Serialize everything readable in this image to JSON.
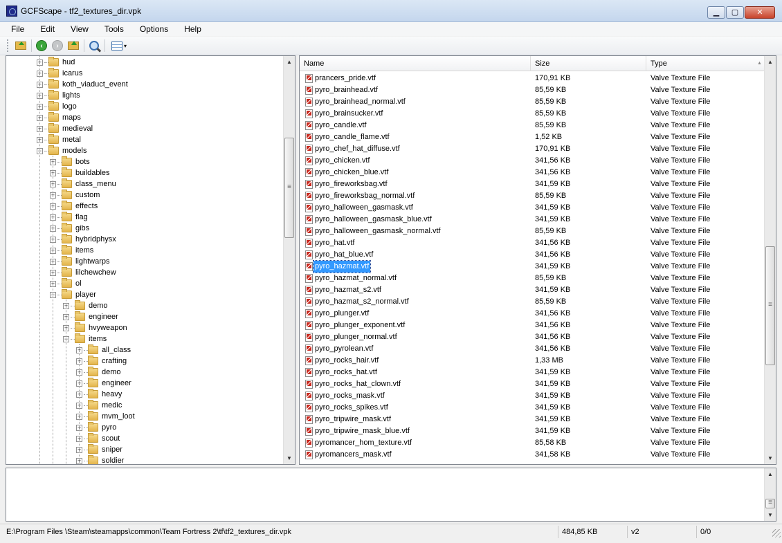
{
  "window": {
    "title": "GCFScape - tf2_textures_dir.vpk",
    "minimize_glyph": "▁",
    "maximize_glyph": "▢",
    "close_glyph": "✕"
  },
  "menu": [
    "File",
    "Edit",
    "View",
    "Tools",
    "Options",
    "Help"
  ],
  "toolbar": {
    "icons": [
      "open-icon",
      "back-icon",
      "forward-icon",
      "up-folder-icon",
      "find-icon",
      "view-mode-icon"
    ],
    "dropdown_glyph": "▾"
  },
  "tree": {
    "items": [
      {
        "label": "hud",
        "level": 2
      },
      {
        "label": "icarus",
        "level": 2
      },
      {
        "label": "koth_viaduct_event",
        "level": 2
      },
      {
        "label": "lights",
        "level": 2
      },
      {
        "label": "logo",
        "level": 2
      },
      {
        "label": "maps",
        "level": 2
      },
      {
        "label": "medieval",
        "level": 2
      },
      {
        "label": "metal",
        "level": 2
      },
      {
        "label": "models",
        "level": 2,
        "expanded": true
      },
      {
        "label": "bots",
        "level": 3
      },
      {
        "label": "buildables",
        "level": 3
      },
      {
        "label": "class_menu",
        "level": 3
      },
      {
        "label": "custom",
        "level": 3
      },
      {
        "label": "effects",
        "level": 3
      },
      {
        "label": "flag",
        "level": 3
      },
      {
        "label": "gibs",
        "level": 3
      },
      {
        "label": "hybridphysx",
        "level": 3
      },
      {
        "label": "items",
        "level": 3
      },
      {
        "label": "lightwarps",
        "level": 3
      },
      {
        "label": "lilchewchew",
        "level": 3
      },
      {
        "label": "ol",
        "level": 3
      },
      {
        "label": "player",
        "level": 3,
        "expanded": true
      },
      {
        "label": "demo",
        "level": 4
      },
      {
        "label": "engineer",
        "level": 4
      },
      {
        "label": "hvyweapon",
        "level": 4
      },
      {
        "label": "items",
        "level": 4,
        "expanded": true
      },
      {
        "label": "all_class",
        "level": 5
      },
      {
        "label": "crafting",
        "level": 5
      },
      {
        "label": "demo",
        "level": 5
      },
      {
        "label": "engineer",
        "level": 5
      },
      {
        "label": "heavy",
        "level": 5
      },
      {
        "label": "medic",
        "level": 5
      },
      {
        "label": "mvm_loot",
        "level": 5
      },
      {
        "label": "pyro",
        "level": 5
      },
      {
        "label": "scout",
        "level": 5
      },
      {
        "label": "sniper",
        "level": 5
      },
      {
        "label": "soldier",
        "level": 5
      }
    ],
    "expand_glyph": "+",
    "collapse_glyph": "−"
  },
  "list": {
    "columns": [
      "Name",
      "Size",
      "Type"
    ],
    "sort_glyph": "▲",
    "rows": [
      {
        "name": "prancers_pride.vtf",
        "size": "170,91 KB",
        "type": "Valve Texture File"
      },
      {
        "name": "pyro_brainhead.vtf",
        "size": "85,59 KB",
        "type": "Valve Texture File"
      },
      {
        "name": "pyro_brainhead_normal.vtf",
        "size": "85,59 KB",
        "type": "Valve Texture File"
      },
      {
        "name": "pyro_brainsucker.vtf",
        "size": "85,59 KB",
        "type": "Valve Texture File"
      },
      {
        "name": "pyro_candle.vtf",
        "size": "85,59 KB",
        "type": "Valve Texture File"
      },
      {
        "name": "pyro_candle_flame.vtf",
        "size": "1,52 KB",
        "type": "Valve Texture File"
      },
      {
        "name": "pyro_chef_hat_diffuse.vtf",
        "size": "170,91 KB",
        "type": "Valve Texture File"
      },
      {
        "name": "pyro_chicken.vtf",
        "size": "341,56 KB",
        "type": "Valve Texture File"
      },
      {
        "name": "pyro_chicken_blue.vtf",
        "size": "341,56 KB",
        "type": "Valve Texture File"
      },
      {
        "name": "pyro_fireworksbag.vtf",
        "size": "341,59 KB",
        "type": "Valve Texture File"
      },
      {
        "name": "pyro_fireworksbag_normal.vtf",
        "size": "85,59 KB",
        "type": "Valve Texture File"
      },
      {
        "name": "pyro_halloween_gasmask.vtf",
        "size": "341,59 KB",
        "type": "Valve Texture File"
      },
      {
        "name": "pyro_halloween_gasmask_blue.vtf",
        "size": "341,59 KB",
        "type": "Valve Texture File"
      },
      {
        "name": "pyro_halloween_gasmask_normal.vtf",
        "size": "85,59 KB",
        "type": "Valve Texture File"
      },
      {
        "name": "pyro_hat.vtf",
        "size": "341,56 KB",
        "type": "Valve Texture File"
      },
      {
        "name": "pyro_hat_blue.vtf",
        "size": "341,56 KB",
        "type": "Valve Texture File"
      },
      {
        "name": "pyro_hazmat.vtf",
        "size": "341,59 KB",
        "type": "Valve Texture File",
        "selected": true
      },
      {
        "name": "pyro_hazmat_normal.vtf",
        "size": "85,59 KB",
        "type": "Valve Texture File"
      },
      {
        "name": "pyro_hazmat_s2.vtf",
        "size": "341,59 KB",
        "type": "Valve Texture File"
      },
      {
        "name": "pyro_hazmat_s2_normal.vtf",
        "size": "85,59 KB",
        "type": "Valve Texture File"
      },
      {
        "name": "pyro_plunger.vtf",
        "size": "341,56 KB",
        "type": "Valve Texture File"
      },
      {
        "name": "pyro_plunger_exponent.vtf",
        "size": "341,56 KB",
        "type": "Valve Texture File"
      },
      {
        "name": "pyro_plunger_normal.vtf",
        "size": "341,56 KB",
        "type": "Valve Texture File"
      },
      {
        "name": "pyro_pyrolean.vtf",
        "size": "341,56 KB",
        "type": "Valve Texture File"
      },
      {
        "name": "pyro_rocks_hair.vtf",
        "size": "1,33 MB",
        "type": "Valve Texture File"
      },
      {
        "name": "pyro_rocks_hat.vtf",
        "size": "341,59 KB",
        "type": "Valve Texture File"
      },
      {
        "name": "pyro_rocks_hat_clown.vtf",
        "size": "341,59 KB",
        "type": "Valve Texture File"
      },
      {
        "name": "pyro_rocks_mask.vtf",
        "size": "341,59 KB",
        "type": "Valve Texture File"
      },
      {
        "name": "pyro_rocks_spikes.vtf",
        "size": "341,59 KB",
        "type": "Valve Texture File"
      },
      {
        "name": "pyro_tripwire_mask.vtf",
        "size": "341,59 KB",
        "type": "Valve Texture File"
      },
      {
        "name": "pyro_tripwire_mask_blue.vtf",
        "size": "341,59 KB",
        "type": "Valve Texture File"
      },
      {
        "name": "pyromancer_hom_texture.vtf",
        "size": "85,58 KB",
        "type": "Valve Texture File"
      },
      {
        "name": "pyromancers_mask.vtf",
        "size": "341,58 KB",
        "type": "Valve Texture File"
      }
    ]
  },
  "status": {
    "path": "E:\\Program Files \\Steam\\steamapps\\common\\Team Fortress 2\\tf\\tf2_textures_dir.vpk",
    "size": "484,85 KB",
    "version": "v2",
    "count": "0/0"
  },
  "scroll_glyphs": {
    "up": "▲",
    "down": "▼"
  },
  "colors": {
    "selection": "#3399ff",
    "titlebar": "#c4d6ed"
  }
}
